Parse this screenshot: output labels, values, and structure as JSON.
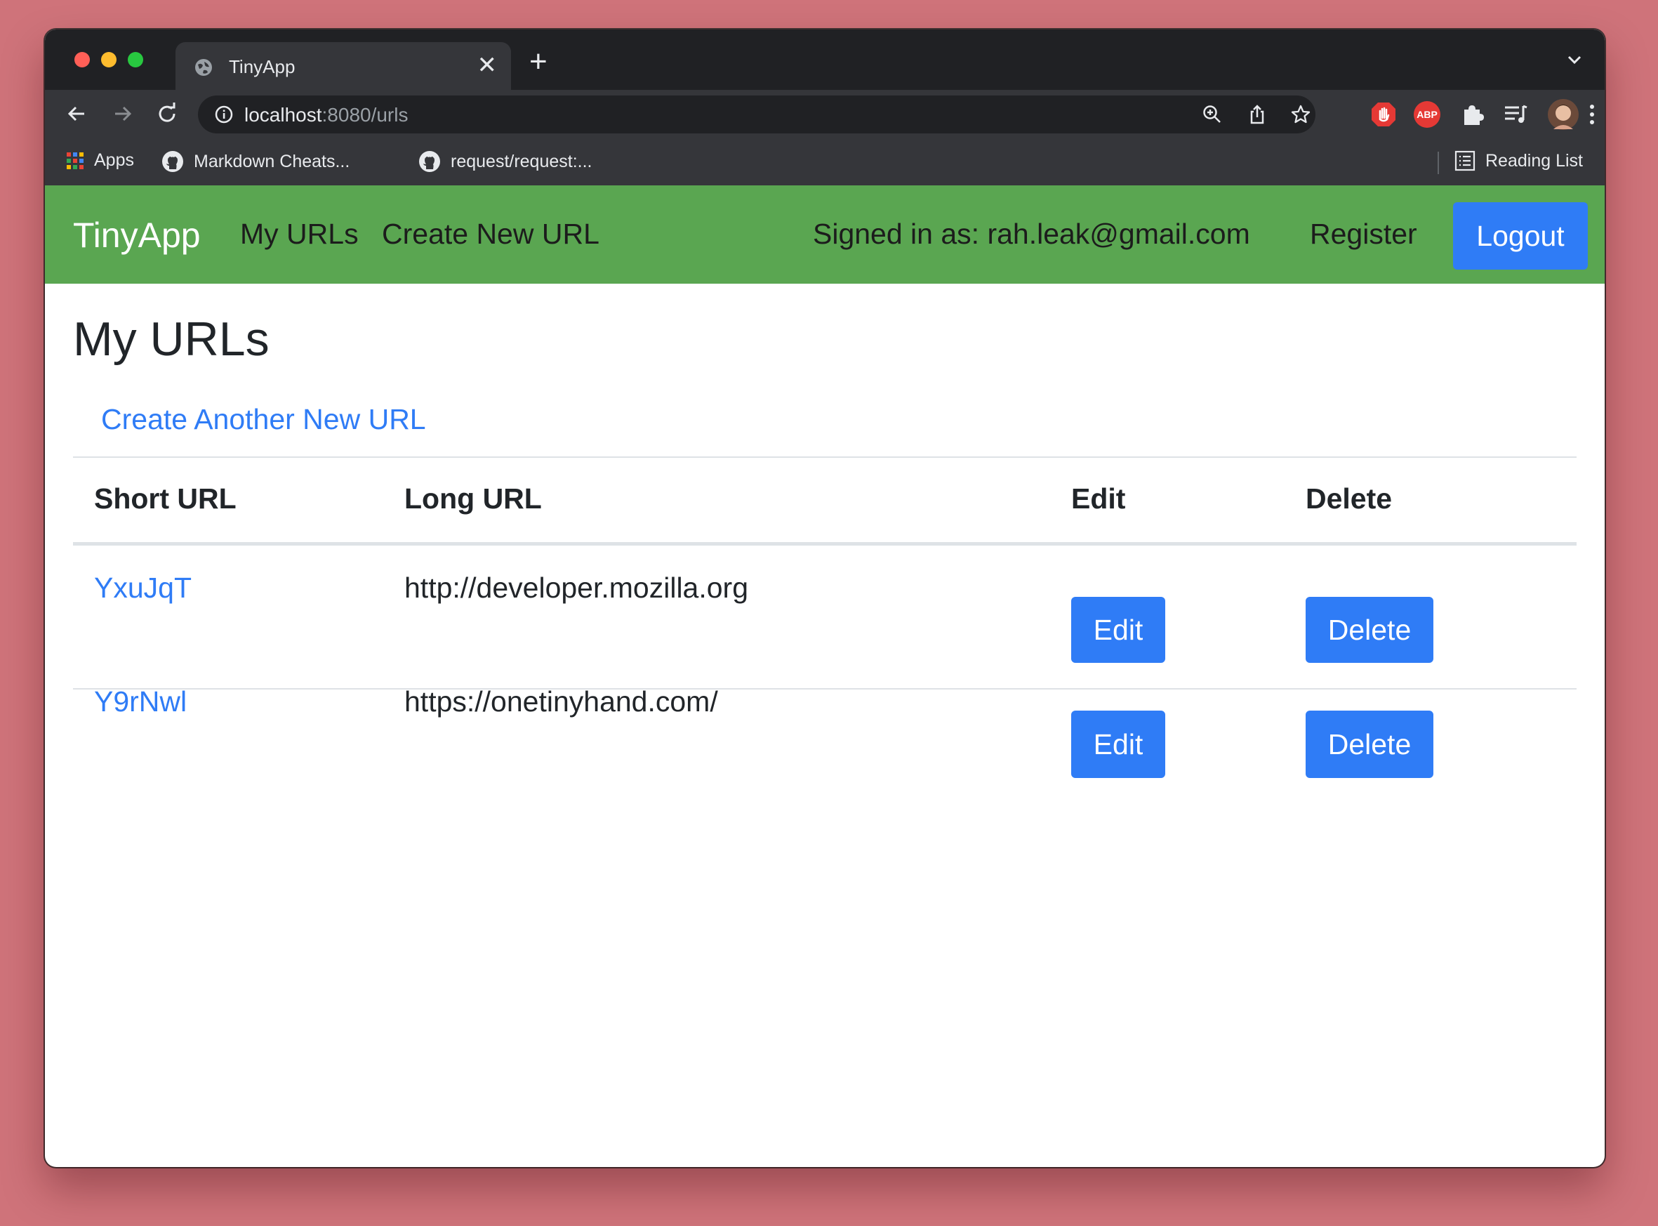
{
  "browser": {
    "tab_title": "TinyApp",
    "new_tab_symbol": "+",
    "close_symbol": "✕",
    "url_host": "localhost",
    "url_rest": ":8080/urls",
    "bookmarks": [
      {
        "label": "Apps"
      },
      {
        "label": "Markdown Cheats..."
      },
      {
        "label": "request/request:..."
      }
    ],
    "reading_list": "Reading List",
    "abp_label": "ABP"
  },
  "navbar": {
    "brand": "TinyApp",
    "my_urls": "My URLs",
    "create_new_url": "Create New URL",
    "signed_in": "Signed in as: rah.leak@gmail.com",
    "register": "Register",
    "logout": "Logout"
  },
  "page": {
    "title": "My URLs",
    "create_link": "Create Another New URL"
  },
  "table": {
    "headers": [
      "Short URL",
      "Long URL",
      "Edit",
      "Delete"
    ],
    "rows": [
      {
        "short": "YxuJqT",
        "long": "http://developer.mozilla.org",
        "edit": "Edit",
        "delete": "Delete"
      },
      {
        "short": "Y9rNwl",
        "long": "https://onetinyhand.com/",
        "edit": "Edit",
        "delete": "Delete"
      }
    ]
  },
  "colors": {
    "navbar": "#5aa651",
    "primary": "#2f7cf6",
    "background": "#cf737a"
  }
}
